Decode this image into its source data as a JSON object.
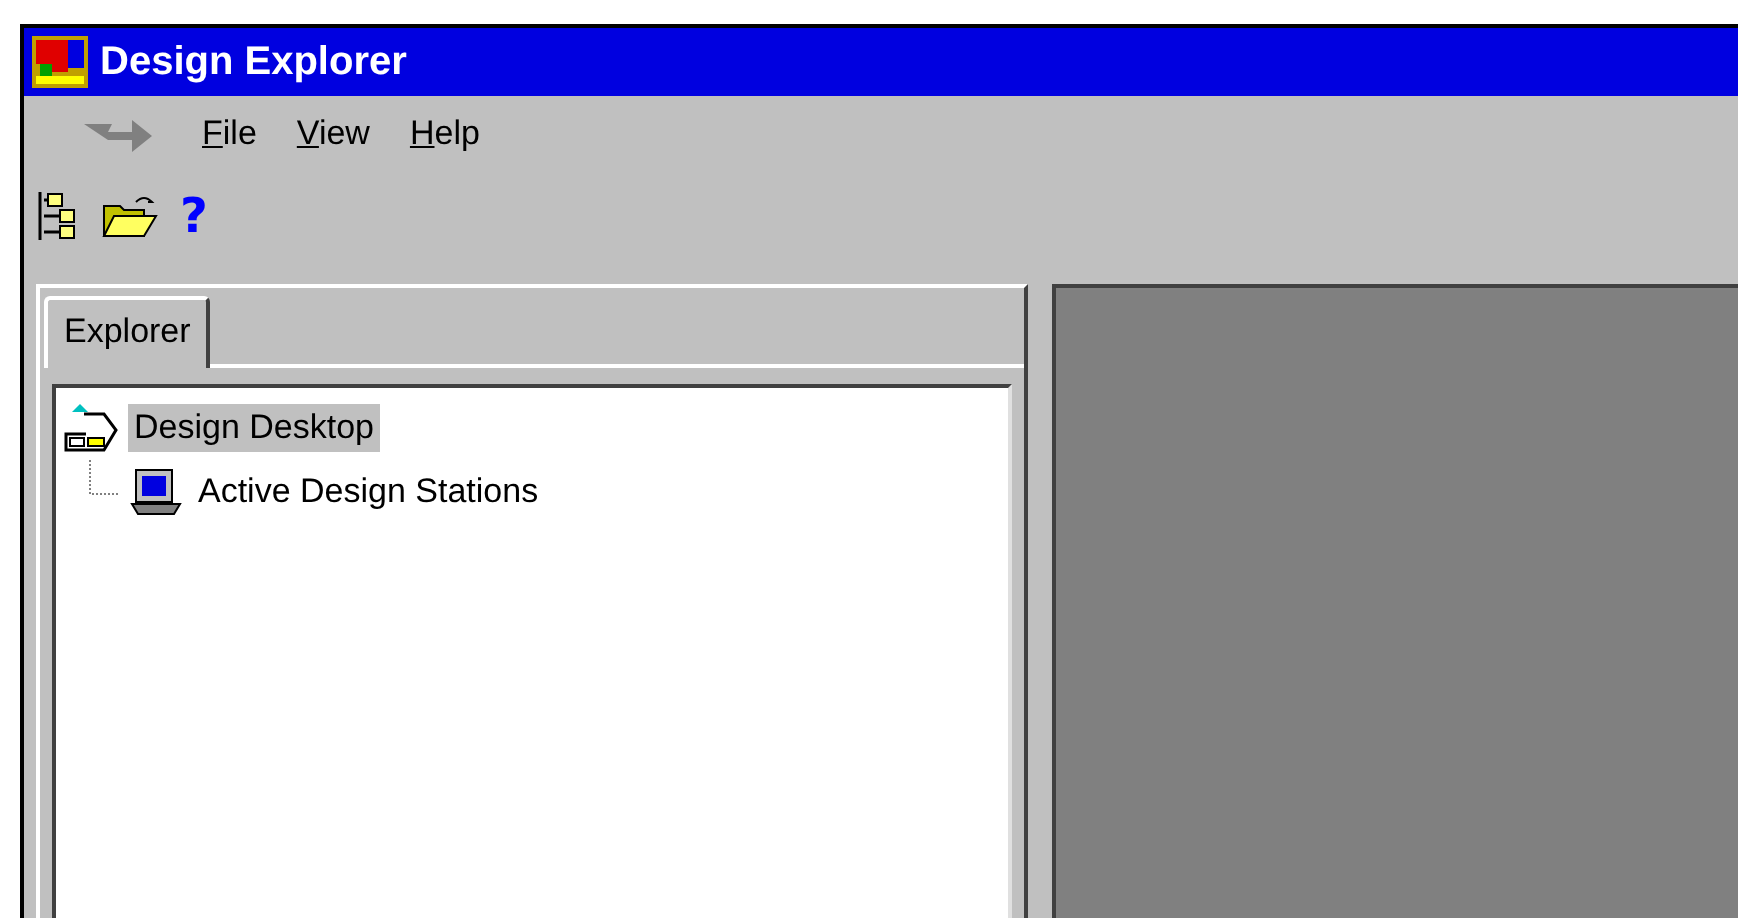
{
  "window": {
    "title": "Design Explorer"
  },
  "menu": [
    {
      "label": "File"
    },
    {
      "label": "View"
    },
    {
      "label": "Help"
    }
  ],
  "toolbar": [
    {
      "kind": "tree"
    },
    {
      "kind": "open"
    },
    {
      "kind": "help",
      "glyph": "?"
    }
  ],
  "explorer": {
    "tabs": [
      {
        "label": "Explorer",
        "selected": true
      }
    ],
    "tree": [
      {
        "label": "Design Desktop",
        "kind": "desktop",
        "selected": true,
        "children": [
          {
            "label": "Active Design Stations",
            "kind": "station",
            "selected": false
          }
        ]
      }
    ]
  }
}
